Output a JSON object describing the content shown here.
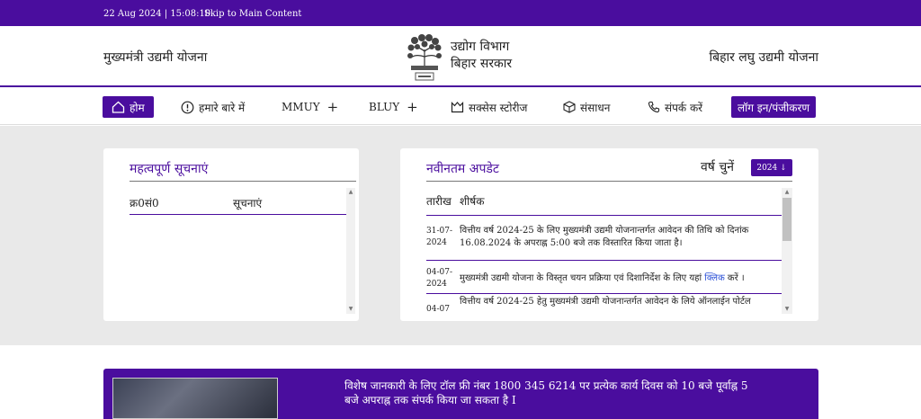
{
  "topbar": {
    "datetime": "22 Aug 2024 | 15:08:10",
    "skip_link": "Skip to Main Content"
  },
  "header": {
    "left_title": "मुख्यमंत्री उद्यमी योजना",
    "dept_line1": "उद्योग विभाग",
    "dept_line2": "बिहार सरकार",
    "right_title": "बिहार लघु उद्यमी योजना"
  },
  "nav": {
    "home": "होम",
    "about": "हमारे बारे में",
    "mmuy": "MMUY",
    "bluy": "BLUY",
    "success": "सक्सेस स्टोरीज",
    "resources": "संसाधन",
    "contact": "संपर्क करें",
    "login": "लॉग इन/पंजीकरण",
    "plus": "+"
  },
  "notices": {
    "title": "महत्वपूर्ण सूचनाएं",
    "col_no": "क्र0सं0",
    "col_notice": "सूचनाएं"
  },
  "updates": {
    "title": "नवीनतम अपडेट",
    "year_label": "वर्ष चुनें",
    "year_value": "2024 ↓",
    "col_date": "तारीख",
    "col_title": "शीर्षक",
    "rows": [
      {
        "date": "31-07-2024",
        "text": "वित्तीय वर्ष 2024-25 के लिए मुख्यमंत्री उद्यमी योजनान्तर्गत आवेदन की तिथि को दिनांक 16.08.2024 के अपराह्न 5:00 बजे तक विस्तारित किया जाता है।"
      },
      {
        "date": "04-07-2024",
        "text_before": "मुख्यमंत्री उद्यमी योजना के विस्तृत चयन प्रक्रिया एवं दिशानिर्देश के लिए यहां ",
        "link": "क्लिक",
        "text_after": " करें ।"
      },
      {
        "date": "04-07",
        "text": "वित्तीय वर्ष 2024-25 हेतु मुख्यमंत्री उद्यमी योजनान्तर्गत आवेदन के लिये ऑनलाईन पोर्टल"
      }
    ]
  },
  "banner": {
    "text": "विशेष जानकारी के लिए टॉल फ्री नंबर 1800 345 6214 पर प्रत्येक कार्य दिवस को 10 बजे पूर्वाह्न 5 बजे अपराह्न तक संपर्क किया जा सकता है I"
  },
  "colors": {
    "brand": "#4a0d9e",
    "link": "#2a4fd6",
    "background_grey": "#e9e9e9"
  },
  "icons": [
    "home-icon",
    "info-icon",
    "success-icon",
    "cube-icon",
    "phone-icon",
    "emblem-icon",
    "scroll-arrow-icon"
  ]
}
